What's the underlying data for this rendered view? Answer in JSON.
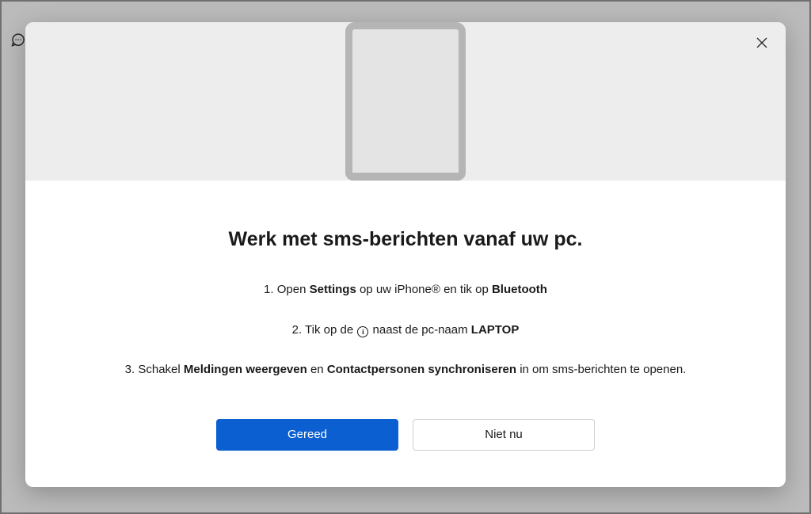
{
  "modal": {
    "title": "Werk met sms-berichten vanaf uw pc.",
    "step1": {
      "num": "1. ",
      "p1": "Open ",
      "bold1": "Settings",
      "p2": " op uw iPhone® en tik op ",
      "bold2": "Bluetooth"
    },
    "step2": {
      "num": "2. ",
      "p1": "Tik op de ",
      "p2": " naast de pc-naam ",
      "bold1": "LAPTOP"
    },
    "step3": {
      "num": "3. ",
      "p1": "Schakel ",
      "bold1": "Meldingen weergeven",
      "p2": " en ",
      "bold2": "Contactpersonen synchroniseren",
      "p3": " in om sms-berichten te openen."
    },
    "buttons": {
      "primary": "Gereed",
      "secondary": "Niet nu"
    }
  }
}
